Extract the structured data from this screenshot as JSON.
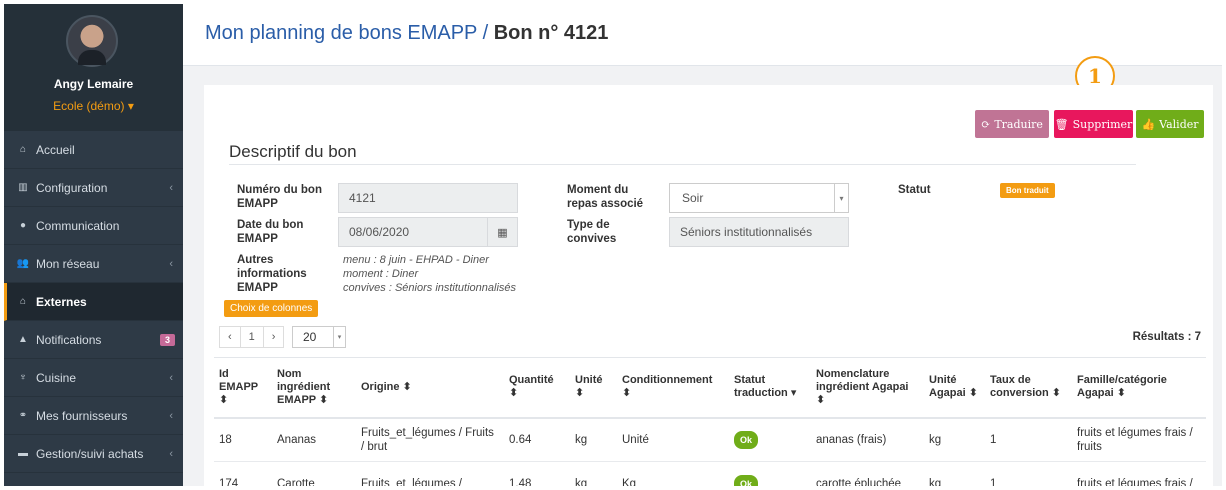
{
  "profile": {
    "name": "Angy Lemaire",
    "school": "Ecole (démo) ▾"
  },
  "nav": [
    {
      "label": "Accueil",
      "icon": "home-icon"
    },
    {
      "label": "Configuration",
      "icon": "bank-icon",
      "chevron": "‹"
    },
    {
      "label": "Communication",
      "icon": "comments-icon"
    },
    {
      "label": "Mon réseau",
      "icon": "users-icon",
      "chevron": "‹"
    },
    {
      "label": "Externes",
      "icon": "home-icon",
      "active": true
    },
    {
      "label": "Notifications",
      "icon": "bell-icon",
      "badge": "3"
    },
    {
      "label": "Cuisine",
      "icon": "utensils-icon",
      "chevron": "‹"
    },
    {
      "label": "Mes fournisseurs",
      "icon": "handshake-icon",
      "chevron": "‹"
    },
    {
      "label": "Gestion/suivi achats",
      "icon": "cart-icon",
      "chevron": "‹"
    }
  ],
  "header": {
    "title_prefix": "Mon planning de bons EMAPP / ",
    "title_bold": "Bon n° 4121"
  },
  "annotation": "1",
  "buttons": {
    "traduire": "Traduire",
    "supprimer": "Supprimer",
    "valider": "Valider"
  },
  "section_title": "Descriptif du bon",
  "form": {
    "numero_label": "Numéro du bon EMAPP",
    "numero_value": "4121",
    "date_label": "Date du bon EMAPP",
    "date_value": "08/06/2020",
    "autres_label": "Autres informations EMAPP",
    "autres_lines": [
      "menu : 8 juin - EHPAD - Diner",
      "moment : Diner",
      "convives : Séniors institutionnalisés"
    ],
    "moment_label": "Moment du repas associé",
    "moment_value": "Soir",
    "type_label": "Type de convives",
    "type_value": "Séniors institutionnalisés",
    "statut_label": "Statut",
    "statut_value": "Bon traduit"
  },
  "choix_colonnes": "Choix de colonnes",
  "pager": {
    "prev": "‹",
    "page": "1",
    "next": "›",
    "page_size": "20"
  },
  "results": "Résultats : 7",
  "table": {
    "headers": [
      "Id EMAPP ⬍",
      "Nom ingrédient EMAPP ⬍",
      "Origine ⬍",
      "Quantité ⬍",
      "Unité ⬍",
      "Conditionnement ⬍",
      "Statut traduction ▾",
      "Nomenclature ingrédient Agapai ⬍",
      "Unité Agapai ⬍",
      "Taux de conversion ⬍",
      "Famille/catégorie Agapai ⬍"
    ],
    "rows": [
      [
        "18",
        "Ananas",
        "Fruits_et_légumes / Fruits / brut",
        "0.64",
        "kg",
        "Unité",
        "Ok",
        "ananas (frais)",
        "kg",
        "1",
        "fruits et légumes frais / fruits"
      ],
      [
        "174",
        "Carotte",
        "Fruits_et_légumes /",
        "1.48",
        "kg",
        "Kg",
        "Ok",
        "carotte épluchée",
        "kg",
        "1",
        "fruits et légumes frais /"
      ]
    ]
  }
}
